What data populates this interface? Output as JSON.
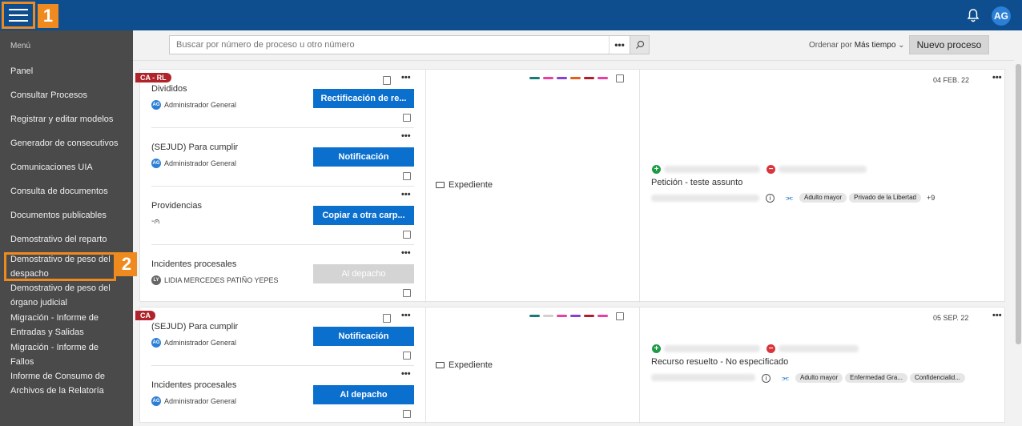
{
  "header": {
    "avatar_initials": "AG",
    "step1": "1",
    "step2": "2"
  },
  "sidebar": {
    "title": "Menú",
    "items": [
      "Panel",
      "Consultar Procesos",
      "Registrar y editar modelos",
      "Generador de consecutivos",
      "Comunicaciones UIA",
      "Consulta de documentos",
      "Documentos publicables",
      "Demostrativo del reparto",
      "Demostrativo de peso del despacho",
      "Demostrativo de peso del órgano judicial",
      "Migración - Informe de Entradas y Salidas",
      "Migración - Informe de Fallos",
      "Informe de Consumo de Archivos de la Relatoría"
    ]
  },
  "toolbar": {
    "search_placeholder": "Buscar por número de proceso u otro número",
    "dots": "•••",
    "order_label": "Ordenar por",
    "order_value": "Más tiempo",
    "new_process": "Nuevo proceso"
  },
  "cards": [
    {
      "tag": "CA - RL",
      "date": "04 FEB. 22",
      "expediente": "Expediente",
      "subject": "Petición - teste assunto",
      "plus_count": "+9",
      "tags": [
        "Adulto mayor",
        "Privado de la Libertad"
      ],
      "bar_colors": [
        "#1a7a7a",
        "#e83fa0",
        "#8a3fd1",
        "#e65c1a",
        "#b01e2a",
        "#e83fa0"
      ],
      "tasks": [
        {
          "title": "Divididos",
          "assignee": "Administrador General",
          "initials": "AG",
          "action": "Rectificación de re..."
        },
        {
          "title": "(SEJUD) Para cumplir",
          "assignee": "Administrador General",
          "initials": "AG",
          "action": "Notificación"
        },
        {
          "title": "Providencias",
          "assignee": "",
          "initials": "",
          "action": "Copiar a otra carp..."
        },
        {
          "title": "Incidentes procesales",
          "assignee": "LIDIA MERCEDES PATIÑO YEPES",
          "initials": "LY",
          "action": "Al depacho"
        }
      ]
    },
    {
      "tag": "CA",
      "date": "05 SEP. 22",
      "expediente": "Expediente",
      "subject": "Recurso resuelto - No especificado",
      "tags": [
        "Adulto mayor",
        "Enfermedad Gra...",
        "Confidencialid..."
      ],
      "bar_colors": [
        "#1a7a7a",
        "#d0d0d0",
        "#e83fa0",
        "#8a3fd1",
        "#b01e2a",
        "#e83fa0"
      ],
      "tasks": [
        {
          "title": "(SEJUD) Para cumplir",
          "assignee": "Administrador General",
          "initials": "AG",
          "action": "Notificación"
        },
        {
          "title": "Incidentes procesales",
          "assignee": "Administrador General",
          "initials": "AG",
          "action": "Al depacho"
        }
      ]
    }
  ]
}
